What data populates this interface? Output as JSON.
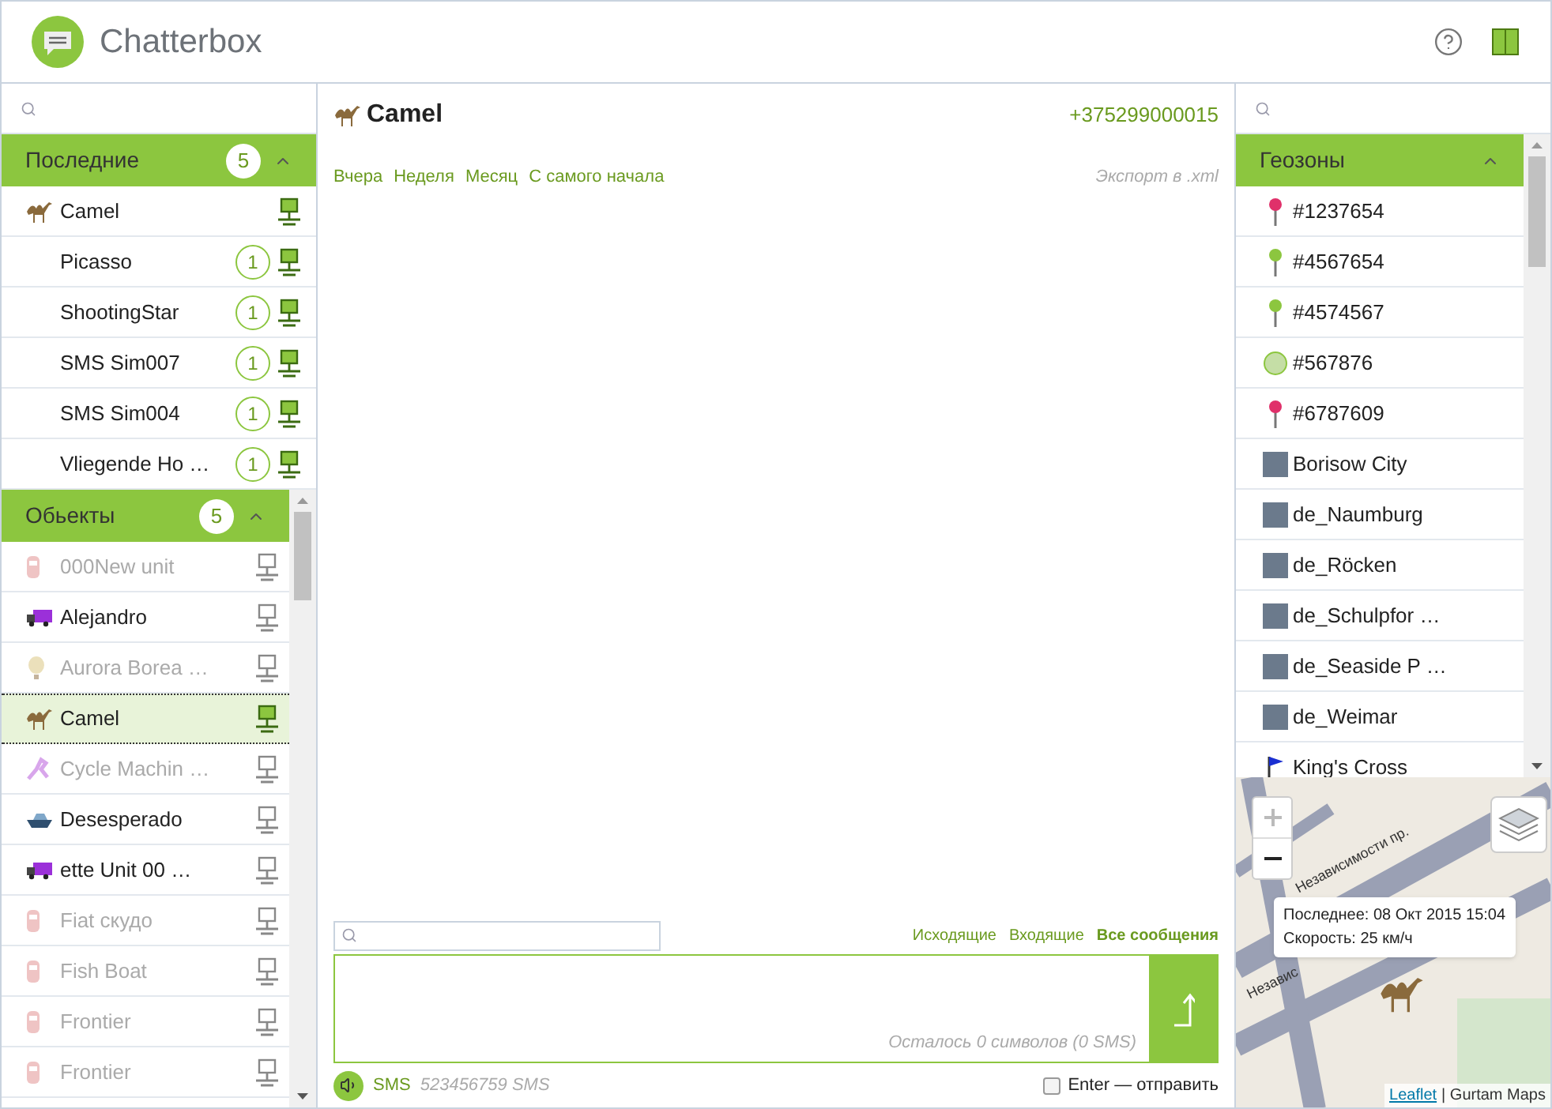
{
  "app": {
    "title": "Chatterbox"
  },
  "recent": {
    "title": "Последние",
    "count": "5",
    "expanded": true,
    "items": [
      {
        "name": "Camel",
        "online": true
      },
      {
        "name": "Picasso",
        "unread": "1",
        "online": true
      },
      {
        "name": "ShootingStar",
        "unread": "1",
        "online": true
      },
      {
        "name": "SMS Sim007",
        "unread": "1",
        "online": true
      },
      {
        "name": "SMS Sim004",
        "unread": "1",
        "online": true
      },
      {
        "name": "Vliegende Ho …",
        "unread": "1",
        "online": true
      }
    ]
  },
  "objects": {
    "title": "Обьекты",
    "count": "5",
    "expanded": true,
    "items": [
      {
        "name": "000New unit",
        "disabled": true,
        "selected": false,
        "online": false
      },
      {
        "name": "Alejandro",
        "disabled": false,
        "selected": false,
        "online": false
      },
      {
        "name": "Aurora Borea …",
        "disabled": true,
        "selected": false,
        "online": false
      },
      {
        "name": "Camel",
        "disabled": false,
        "selected": true,
        "online": true
      },
      {
        "name": "Cycle Machin …",
        "disabled": true,
        "selected": false,
        "online": false
      },
      {
        "name": "Desesperado",
        "disabled": false,
        "selected": false,
        "online": false
      },
      {
        "name": "ette Unit 00 …",
        "disabled": false,
        "selected": false,
        "online": false
      },
      {
        "name": "Fiat скудо",
        "disabled": true,
        "selected": false,
        "online": false
      },
      {
        "name": "Fish Boat",
        "disabled": true,
        "selected": false,
        "online": false
      },
      {
        "name": "Frontier",
        "disabled": true,
        "selected": false,
        "online": false
      },
      {
        "name": "Frontier",
        "disabled": true,
        "selected": false,
        "online": false
      }
    ]
  },
  "chat": {
    "unit": "Camel",
    "phone": "+375299000015",
    "periods": [
      {
        "label": "Вчера",
        "selected": false
      },
      {
        "label": "Неделя",
        "selected": false
      },
      {
        "label": "Месяц",
        "selected": false
      },
      {
        "label": "С самого начала",
        "selected": false
      }
    ],
    "export": "Экспорт в .xml",
    "filters": [
      {
        "label": "Исходящие",
        "selected": false
      },
      {
        "label": "Входящие",
        "selected": false
      },
      {
        "label": "Все сообщения",
        "selected": true
      }
    ],
    "remaining": "Осталось 0 символов (0 SMS)",
    "channel": "SMS",
    "channel_info": "523456759 SMS",
    "enter_send": {
      "label": "Enter — отправить",
      "checked": false
    }
  },
  "geozones": {
    "title": "Геозоны",
    "expanded": true,
    "items": [
      {
        "name": "#1237654",
        "kind": "pin",
        "color": "#e0306a"
      },
      {
        "name": "#4567654",
        "kind": "pin",
        "color": "#8cc63f"
      },
      {
        "name": "#4574567",
        "kind": "pin",
        "color": "#8cc63f"
      },
      {
        "name": "#567876",
        "kind": "circle",
        "color": "#c5dea6"
      },
      {
        "name": "#6787609",
        "kind": "pin",
        "color": "#e0306a"
      },
      {
        "name": "Borisow City",
        "kind": "image"
      },
      {
        "name": "de_Naumburg",
        "kind": "image"
      },
      {
        "name": "de_Röcken",
        "kind": "image"
      },
      {
        "name": "de_Schulpfor …",
        "kind": "image"
      },
      {
        "name": "de_Seaside P …",
        "kind": "image"
      },
      {
        "name": "de_Weimar",
        "kind": "image"
      },
      {
        "name": "King's Cross",
        "kind": "flag"
      }
    ]
  },
  "map": {
    "streets": [
      "Независимости пр.",
      "Независ"
    ],
    "popup": {
      "last": "Последнее: 08 Окт 2015 15:04",
      "speed": "Скорость: 25 км/ч"
    },
    "attribution_link": "Leaflet",
    "attribution_text": "| Gurtam Maps"
  }
}
